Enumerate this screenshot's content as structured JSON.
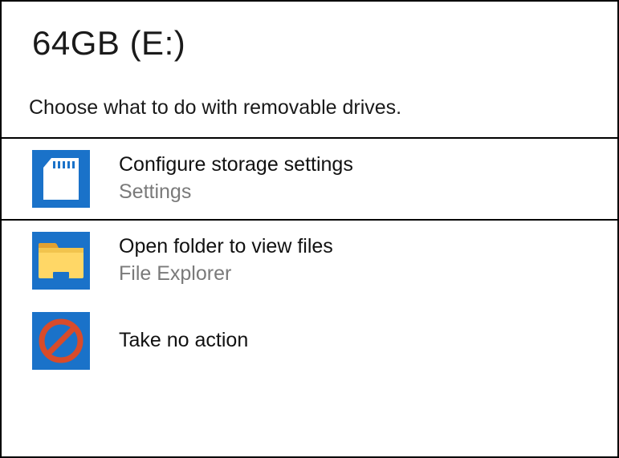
{
  "header": {
    "title": "64GB (E:)",
    "subtitle": "Choose what to do with removable drives."
  },
  "options": [
    {
      "icon": "sd-card",
      "primary": "Configure storage settings",
      "secondary": "Settings"
    },
    {
      "icon": "folder",
      "primary": "Open folder to view files",
      "secondary": "File Explorer"
    },
    {
      "icon": "no-action",
      "primary": "Take no action",
      "secondary": ""
    }
  ]
}
